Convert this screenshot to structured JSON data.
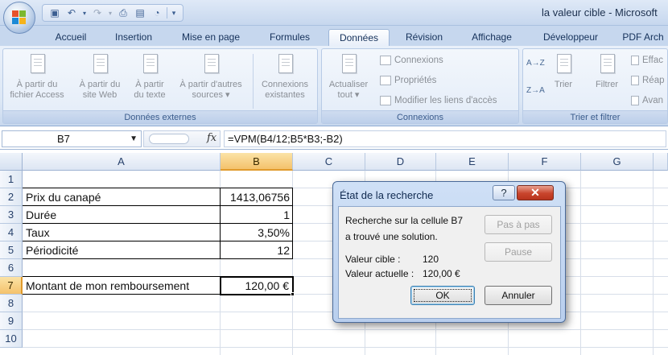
{
  "window": {
    "title": "la valeur cible - Microsoft"
  },
  "ribbon_tabs": [
    "Accueil",
    "Insertion",
    "Mise en page",
    "Formules",
    "Données",
    "Révision",
    "Affichage",
    "Développeur",
    "PDF Arch"
  ],
  "active_tab": "Données",
  "ribbon": {
    "external_data": {
      "label": "Données externes",
      "buttons": [
        {
          "line1": "À partir du",
          "line2": "fichier Access"
        },
        {
          "line1": "À partir du",
          "line2": "site Web"
        },
        {
          "line1": "À partir",
          "line2": "du texte"
        },
        {
          "line1": "À partir d'autres",
          "line2": "sources ▾"
        },
        {
          "line1": "Connexions",
          "line2": "existantes"
        }
      ]
    },
    "connections": {
      "label": "Connexions",
      "refresh_line1": "Actualiser",
      "refresh_line2": "tout ▾",
      "connexions": "Connexions",
      "proprietes": "Propriétés",
      "modifier_liens": "Modifier les liens d'accès"
    },
    "sort_filter": {
      "label": "Trier et filtrer",
      "sort_az": "A→Z",
      "sort_za": "Z→A",
      "trier": "Trier",
      "filtrer": "Filtrer",
      "effacer": "Effac",
      "reappliquer": "Réap",
      "avance": "Avan"
    }
  },
  "formula_bar": {
    "name_box": "B7",
    "fx": "fx",
    "formula": "=VPM(B4/12;B5*B3;-B2)"
  },
  "sheet": {
    "columns": [
      "A",
      "B",
      "C",
      "D",
      "E",
      "F",
      "G"
    ],
    "selected_column": "B",
    "rows": [
      "1",
      "2",
      "3",
      "4",
      "5",
      "6",
      "7",
      "8",
      "9",
      "10"
    ],
    "selected_row": "7",
    "cells": {
      "A2": "Prix du canapé",
      "B2": "1413,06756",
      "A3": "Durée",
      "B3": "1",
      "A4": "Taux",
      "B4": "3,50%",
      "A5": "Périodicité",
      "B5": "12",
      "A7": "Montant de mon remboursement",
      "B7": "120,00 €"
    }
  },
  "dialog": {
    "title": "État de la recherche",
    "help": "?",
    "close": "✕",
    "line1": "Recherche sur la cellule B7",
    "line2": "a trouvé une solution.",
    "target_label": "Valeur cible :",
    "target_value": "120",
    "current_label": "Valeur actuelle :",
    "current_value": "120,00 €",
    "step_button": "Pas à pas",
    "pause_button": "Pause",
    "ok_button": "OK",
    "cancel_button": "Annuler"
  }
}
